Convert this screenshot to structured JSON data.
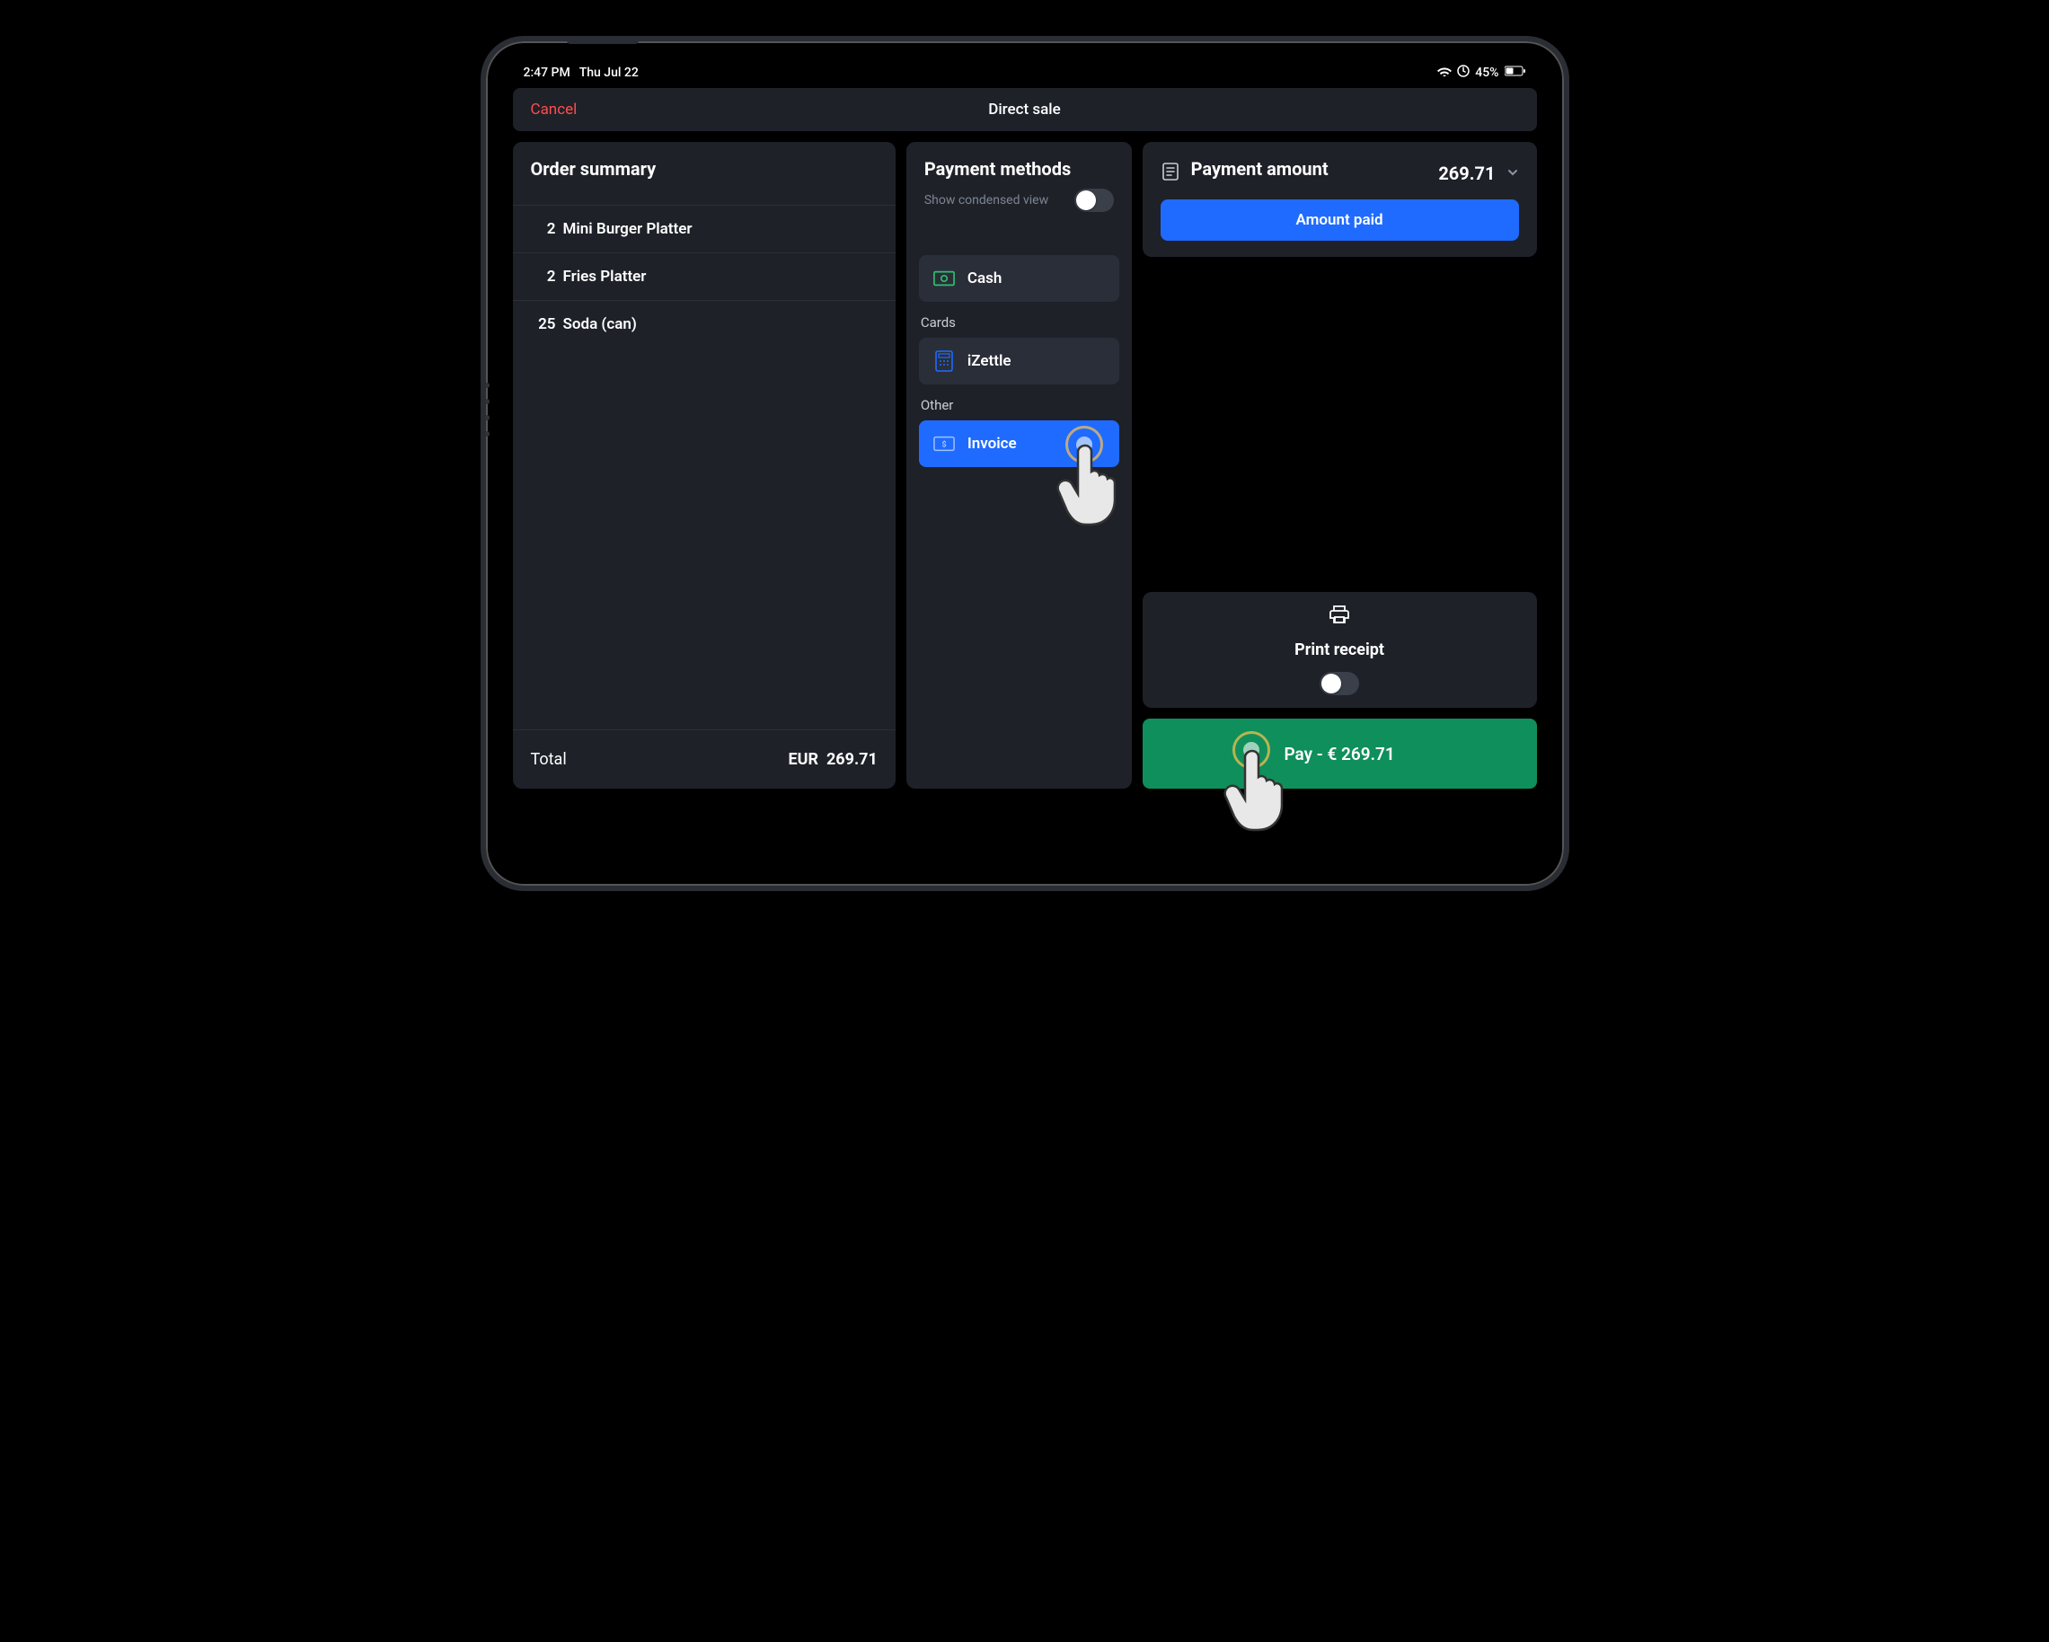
{
  "status": {
    "time": "2:47 PM",
    "date": "Thu Jul 22",
    "battery": "45%"
  },
  "nav": {
    "cancel": "Cancel",
    "title": "Direct sale"
  },
  "summary": {
    "heading": "Order summary",
    "items": [
      {
        "qty": "2",
        "name": "Mini Burger Platter"
      },
      {
        "qty": "2",
        "name": "Fries Platter"
      },
      {
        "qty": "25",
        "name": "Soda (can)"
      }
    ],
    "total_label": "Total",
    "total_currency": "EUR",
    "total_amount": "269.71"
  },
  "methods": {
    "heading": "Payment methods",
    "condensed_label": "Show condensed view",
    "cash": "Cash",
    "cards_label": "Cards",
    "izettle": "iZettle",
    "other_label": "Other",
    "invoice": "Invoice",
    "selected": "invoice"
  },
  "amount": {
    "heading": "Payment amount",
    "value": "269.71",
    "paid_button": "Amount paid"
  },
  "print": {
    "label": "Print receipt"
  },
  "pay": {
    "label": "Pay - € 269.71"
  }
}
